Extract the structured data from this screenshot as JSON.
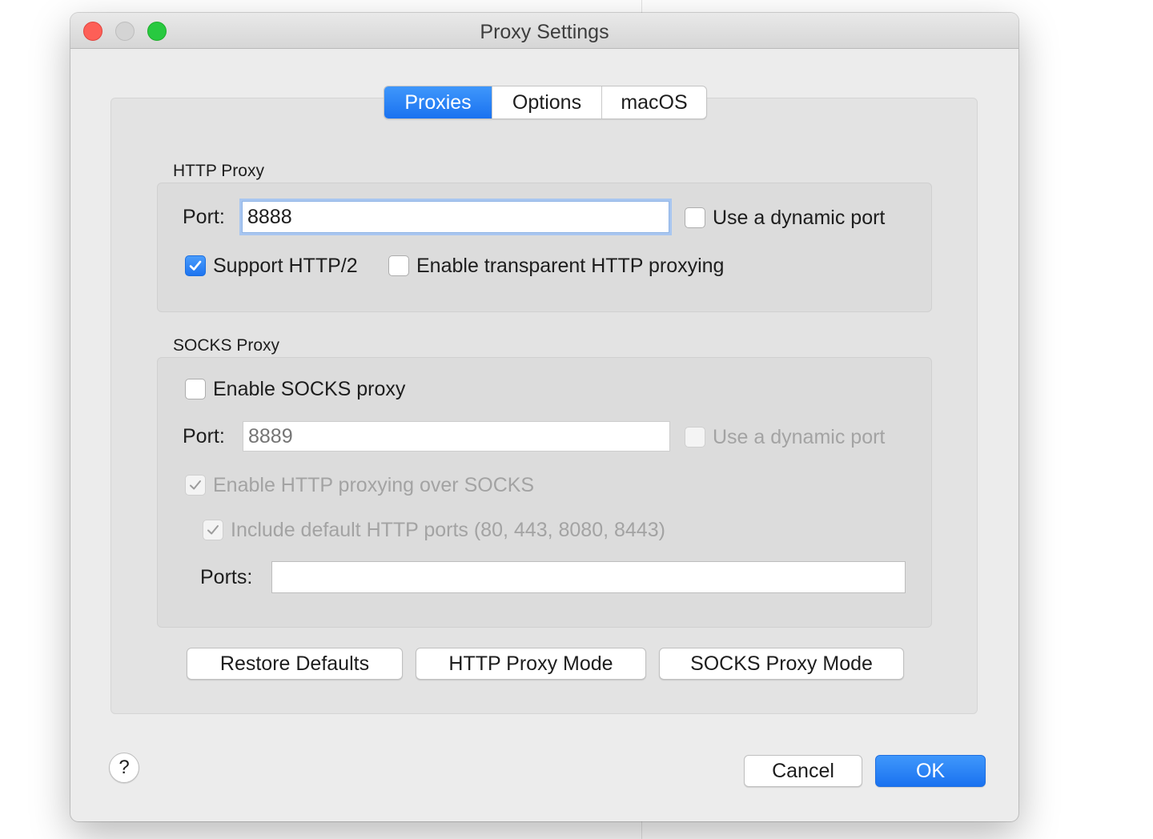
{
  "window": {
    "title": "Proxy Settings"
  },
  "tabs": [
    {
      "label": "Proxies",
      "active": true
    },
    {
      "label": "Options",
      "active": false
    },
    {
      "label": "macOS",
      "active": false
    }
  ],
  "http_proxy": {
    "section_label": "HTTP Proxy",
    "port_label": "Port:",
    "port_value": "8888",
    "dynamic_port_label": "Use a dynamic port",
    "dynamic_port_checked": false,
    "support_http2_label": "Support HTTP/2",
    "support_http2_checked": true,
    "transparent_label": "Enable transparent HTTP proxying",
    "transparent_checked": false
  },
  "socks_proxy": {
    "section_label": "SOCKS Proxy",
    "enable_label": "Enable SOCKS proxy",
    "enable_checked": false,
    "port_label": "Port:",
    "port_placeholder": "8889",
    "dynamic_port_label": "Use a dynamic port",
    "http_over_socks_label": "Enable HTTP proxying over SOCKS",
    "http_over_socks_checked": true,
    "include_default_ports_label": "Include default HTTP ports (80, 443, 8080, 8443)",
    "include_default_ports_checked": true,
    "ports_label": "Ports:",
    "ports_value": ""
  },
  "mode_buttons": {
    "restore_defaults": "Restore Defaults",
    "http_proxy_mode": "HTTP Proxy Mode",
    "socks_proxy_mode": "SOCKS Proxy Mode"
  },
  "footer": {
    "help": "?",
    "cancel": "Cancel",
    "ok": "OK"
  },
  "colors": {
    "accent": "#1a72f0",
    "window_bg": "#ececec",
    "close": "#fd5f57",
    "zoom": "#28c940"
  }
}
